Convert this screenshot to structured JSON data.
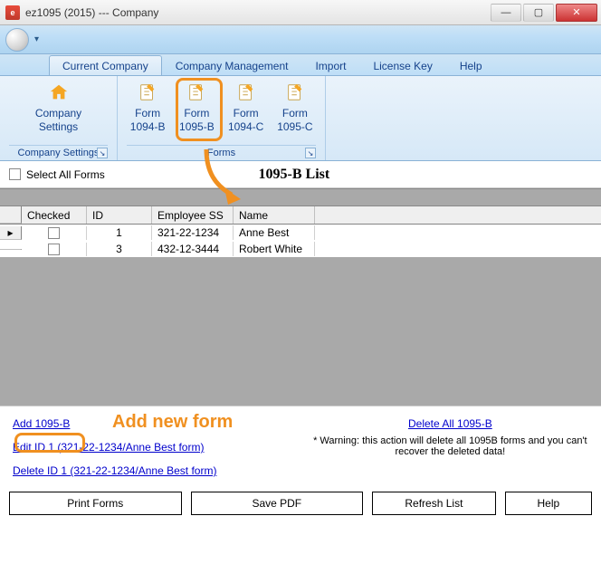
{
  "window": {
    "title": "ez1095 (2015) --- Company"
  },
  "tabs": {
    "current": "Current Company",
    "items": [
      "Current Company",
      "Company Management",
      "Import",
      "License Key",
      "Help"
    ]
  },
  "ribbon": {
    "group1": {
      "label": "Company Settings",
      "btn": {
        "line1": "Company",
        "line2": "Settings"
      }
    },
    "group2": {
      "label": "Forms",
      "btns": [
        {
          "line1": "Form",
          "line2": "1094-B"
        },
        {
          "line1": "Form",
          "line2": "1095-B"
        },
        {
          "line1": "Form",
          "line2": "1094-C"
        },
        {
          "line1": "Form",
          "line2": "1095-C"
        }
      ]
    }
  },
  "selectall": {
    "label": "Select All Forms"
  },
  "list": {
    "title": "1095-B List"
  },
  "grid": {
    "headers": [
      "Checked",
      "ID",
      "Employee SS",
      "Name"
    ],
    "rows": [
      {
        "checked": false,
        "id": "1",
        "ss": "321-22-1234",
        "name": "Anne Best"
      },
      {
        "checked": false,
        "id": "3",
        "ss": "432-12-3444",
        "name": "Robert White"
      }
    ]
  },
  "links": {
    "add": "Add 1095-B",
    "edit": "Edit ID 1 (321-22-1234/Anne Best form)",
    "delete": "Delete ID 1 (321-22-1234/Anne Best form)",
    "deleteall": "Delete All 1095-B",
    "warning": "* Warning: this action will delete all 1095B forms and you can't recover the deleted data!"
  },
  "annotation": {
    "addnew": "Add new form"
  },
  "buttons": {
    "print": "Print Forms",
    "save": "Save PDF",
    "refresh": "Refresh List",
    "help": "Help"
  }
}
